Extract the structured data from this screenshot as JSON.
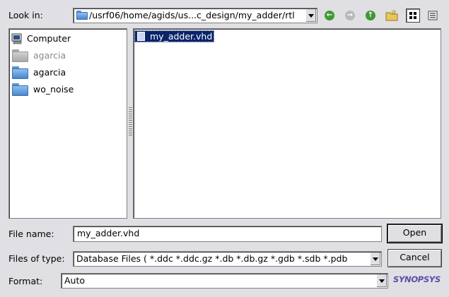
{
  "look_in": {
    "label": "Look in:",
    "path": "/usrf06/home/agids/us...c_design/my_adder/rtl"
  },
  "toolbar": {
    "icons": [
      "back-icon",
      "forward-icon",
      "parent-directory-icon",
      "new-folder-icon",
      "list-view-icon",
      "detail-view-icon"
    ]
  },
  "sidebar": {
    "items": [
      {
        "label": "Computer",
        "icon": "computer-icon",
        "disabled": false
      },
      {
        "label": "agarcia",
        "icon": "folder-icon",
        "disabled": true
      },
      {
        "label": "agarcia",
        "icon": "folder-icon",
        "disabled": false
      },
      {
        "label": "wo_noise",
        "icon": "folder-icon",
        "disabled": false
      }
    ]
  },
  "files": {
    "items": [
      {
        "name": "my_adder.vhd",
        "selected": true
      }
    ]
  },
  "file_name": {
    "label": "File name:",
    "value": "my_adder.vhd"
  },
  "files_of_type": {
    "label": "Files of type:",
    "value": "Database Files ( *.ddc *.ddc.gz *.db *.db.gz *.gdb *.sdb *.pdb"
  },
  "format": {
    "label": "Format:",
    "value": "Auto"
  },
  "buttons": {
    "open": "Open",
    "cancel": "Cancel"
  },
  "logo": {
    "text": "SYNOPSYS",
    "color": "#5b4fa8"
  },
  "colors": {
    "selection": "#0a246a",
    "dialog_bg": "#e0dfe3"
  }
}
